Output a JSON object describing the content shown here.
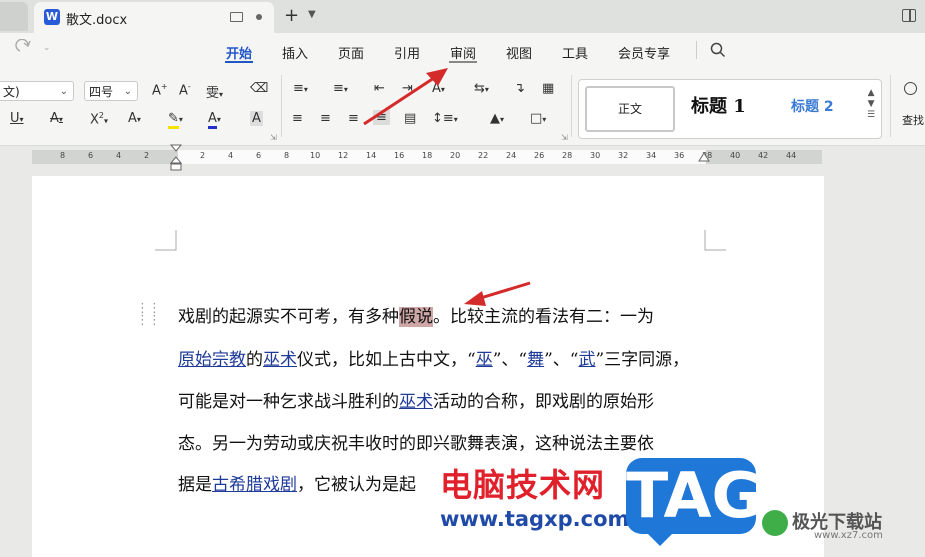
{
  "titlebar": {
    "doc_name": "散文.docx",
    "app_letter": "W",
    "new_tab_symbol": "+"
  },
  "menubar": {
    "items": [
      "开始",
      "插入",
      "页面",
      "引用",
      "审阅",
      "视图",
      "工具",
      "会员专享"
    ],
    "active": "开始"
  },
  "ribbon": {
    "font_name": "文)",
    "font_size": "四号",
    "style_normal": "正文",
    "style_h1": "标题 1",
    "style_h2": "标题 2",
    "find_label": "查找"
  },
  "ruler": {
    "left_labels": [
      "8",
      "6",
      "4",
      "2"
    ],
    "right_labels": [
      "2",
      "4",
      "6",
      "8",
      "10",
      "12",
      "14",
      "16",
      "18",
      "20",
      "22",
      "24",
      "26",
      "28",
      "30",
      "32",
      "34",
      "36",
      "38",
      "40",
      "42",
      "44"
    ]
  },
  "document": {
    "line1": {
      "pre": "戏剧的起源实不可考，有多种",
      "selected": "假说",
      "post": "。比较主流的看法有二：一为"
    },
    "line2": {
      "link1": "原始宗教",
      "t1": "的",
      "link2": "巫术",
      "t2": "仪式，比如上古中文，“",
      "link3": "巫",
      "t3": "”、“",
      "link4": "舞",
      "t4": "”、“",
      "link5": "武",
      "t5": "”三字同源，"
    },
    "line3": {
      "t1": "可能是对一种乞求战斗胜利的",
      "link1": "巫术",
      "t2": "活动的合称，即戏剧的原始形"
    },
    "line4": "态。另一为劳动或庆祝丰收时的即兴歌舞表演，这种说法主要依",
    "line5": {
      "t1": "据是",
      "link1": "古希腊戏剧",
      "t2": "，它被认为是起"
    }
  },
  "watermark": {
    "cn": "电脑技术网",
    "url": "www.tagxp.com",
    "tag": "TAG",
    "jg_text": "极光下载站",
    "jg_url": "www.xz7.com"
  },
  "colors": {
    "accent": "#2156c7",
    "link": "#1f3b9a",
    "selection": "#cfa7a7",
    "arrow": "#d42a2a"
  }
}
